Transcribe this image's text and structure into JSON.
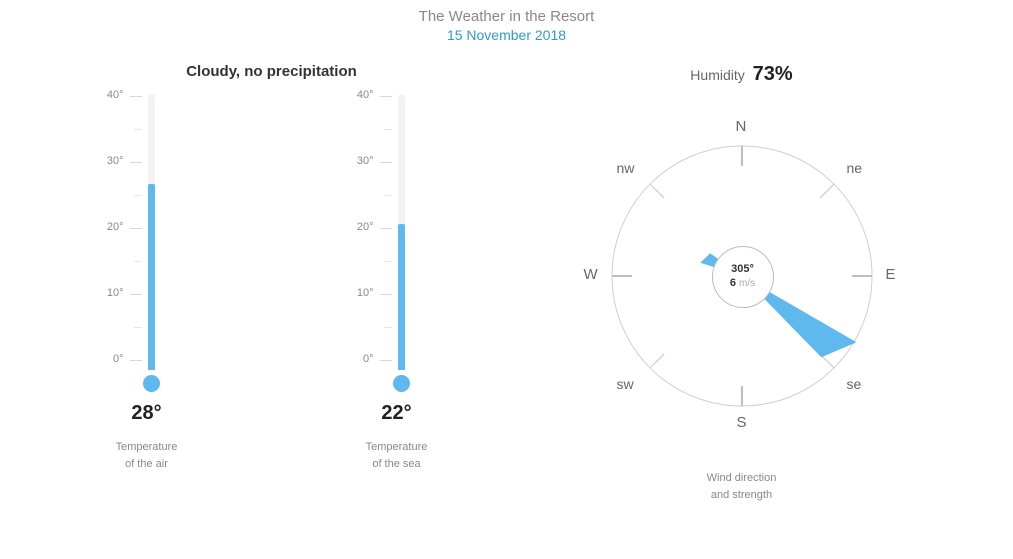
{
  "title": "The Weather in the Resort",
  "date": "15 November 2018",
  "condition": "Cloudy, no precipitation",
  "humidity_label": "Humidity",
  "humidity_value": "73%",
  "thermometers": {
    "air": {
      "value_label": "28°",
      "caption_l1": "Temperature",
      "caption_l2": "of the air",
      "ticks": {
        "t40": "40°",
        "t30": "30°",
        "t20": "20°",
        "t10": "10°",
        "t0": "0°"
      }
    },
    "sea": {
      "value_label": "22°",
      "caption_l1": "Temperature",
      "caption_l2": "of the sea",
      "ticks": {
        "t40": "40°",
        "t30": "30°",
        "t20": "20°",
        "t10": "10°",
        "t0": "0°"
      }
    }
  },
  "compass": {
    "degrees_label": "305°",
    "speed_value": "6",
    "speed_unit": "m/s",
    "caption_l1": "Wind direction",
    "caption_l2": "and strength",
    "labels": {
      "n": "N",
      "ne": "ne",
      "e": "E",
      "se": "se",
      "s": "S",
      "sw": "sw",
      "w": "W",
      "nw": "nw"
    }
  },
  "chart_data": [
    {
      "type": "bar",
      "title": "Temperature of the air",
      "categories": [
        "Air"
      ],
      "values": [
        28
      ],
      "ylabel": "°",
      "ylim": [
        0,
        40
      ]
    },
    {
      "type": "bar",
      "title": "Temperature of the sea",
      "categories": [
        "Sea"
      ],
      "values": [
        22
      ],
      "ylabel": "°",
      "ylim": [
        0,
        40
      ]
    },
    {
      "type": "gauge",
      "title": "Wind direction and strength",
      "direction_degrees": 305,
      "speed": 6,
      "speed_unit": "m/s",
      "range": [
        0,
        360
      ]
    },
    {
      "type": "scalar",
      "title": "Humidity",
      "value": 73,
      "unit": "%",
      "range": [
        0,
        100
      ]
    }
  ]
}
